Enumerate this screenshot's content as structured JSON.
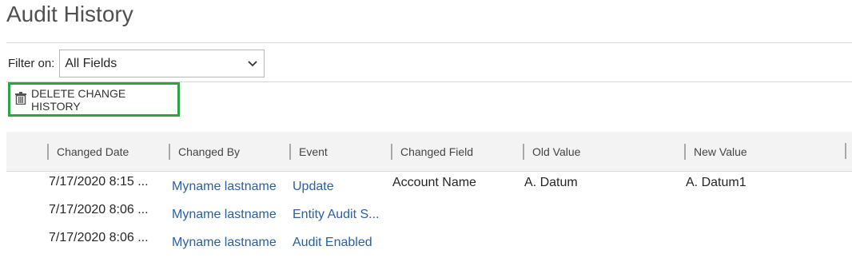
{
  "page": {
    "title": "Audit History"
  },
  "filter": {
    "label": "Filter on:",
    "selected": "All Fields"
  },
  "toolbar": {
    "delete_label": "DELETE CHANGE HISTORY"
  },
  "grid": {
    "columns": [
      "Changed Date",
      "Changed By",
      "Event",
      "Changed Field",
      "Old Value",
      "New Value"
    ],
    "rows": [
      {
        "date": "7/17/2020 8:15 ...",
        "changed_by": "Myname lastname",
        "event": "Update",
        "field": "Account Name",
        "old_value": "A. Datum",
        "new_value": "A. Datum1"
      },
      {
        "date": "7/17/2020 8:06 ...",
        "changed_by": "Myname lastname",
        "event": "Entity Audit S...",
        "field": "",
        "old_value": "",
        "new_value": ""
      },
      {
        "date": "7/17/2020 8:06 ...",
        "changed_by": "Myname lastname",
        "event": "Audit Enabled",
        "field": "",
        "old_value": "",
        "new_value": ""
      }
    ]
  },
  "colors": {
    "accent_border": "#29a545",
    "link": "#2a5fa5",
    "header_bg": "#f3f3f3"
  },
  "icons": {
    "delete": "trash-icon",
    "dropdown": "chevron-down-icon"
  }
}
